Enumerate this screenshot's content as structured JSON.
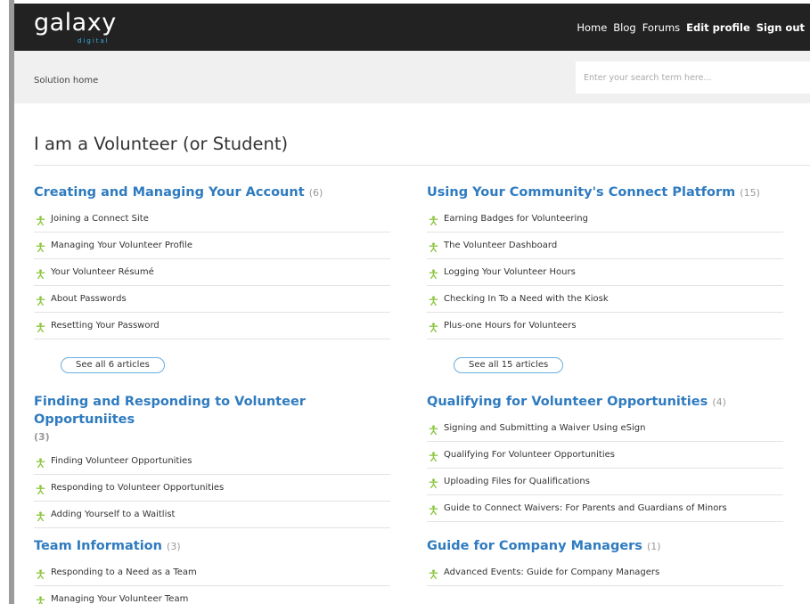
{
  "brand": {
    "logo_text": "galaxy",
    "logo_sub": "digital"
  },
  "nav": {
    "home": "Home",
    "blog": "Blog",
    "forums": "Forums",
    "edit_profile": "Edit profile",
    "sign_out": "Sign out"
  },
  "breadcrumb": "Solution home",
  "search": {
    "placeholder": "Enter your search term here..."
  },
  "title": "I am a Volunteer (or Student)",
  "colors": {
    "header_bg": "#222222",
    "link_blue": "#2f7bbf",
    "icon_green": "#8cc63f",
    "logo_blue": "#3ab0e6"
  },
  "sections": [
    {
      "title": "Creating and Managing Your Account",
      "count": "(6)",
      "items": [
        "Joining a Connect Site",
        "Managing Your Volunteer Profile",
        "Your Volunteer Résumé",
        "About Passwords",
        "Resetting Your Password"
      ],
      "see_all": "See all 6 articles"
    },
    {
      "title": "Using Your Community's Connect Platform",
      "count": "(15)",
      "items": [
        "Earning Badges for Volunteering",
        "The Volunteer Dashboard",
        "Logging Your Volunteer Hours",
        "Checking In To a Need with the Kiosk",
        "Plus-one Hours for Volunteers"
      ],
      "see_all": "See all 15 articles"
    },
    {
      "title": "Finding and Responding to Volunteer Opportuniites",
      "count": "(3)",
      "items": [
        "Finding Volunteer Opportunities",
        "Responding to Volunteer Opportunities",
        "Adding Yourself to a Waitlist"
      ]
    },
    {
      "title": "Qualifying for Volunteer Opportunities",
      "count": "(4)",
      "items": [
        "Signing and Submitting a Waiver Using eSign",
        "Qualifying For Volunteer Opportunities",
        "Uploading Files for Qualifications",
        "Guide to Connect Waivers: For Parents and Guardians of Minors"
      ]
    },
    {
      "title": "Team Information",
      "count": "(3)",
      "items": [
        "Responding to a Need as a Team",
        "Managing Your Volunteer Team"
      ]
    },
    {
      "title": "Guide for Company Managers",
      "count": "(1)",
      "items": [
        "Advanced Events: Guide for Company Managers"
      ]
    }
  ]
}
